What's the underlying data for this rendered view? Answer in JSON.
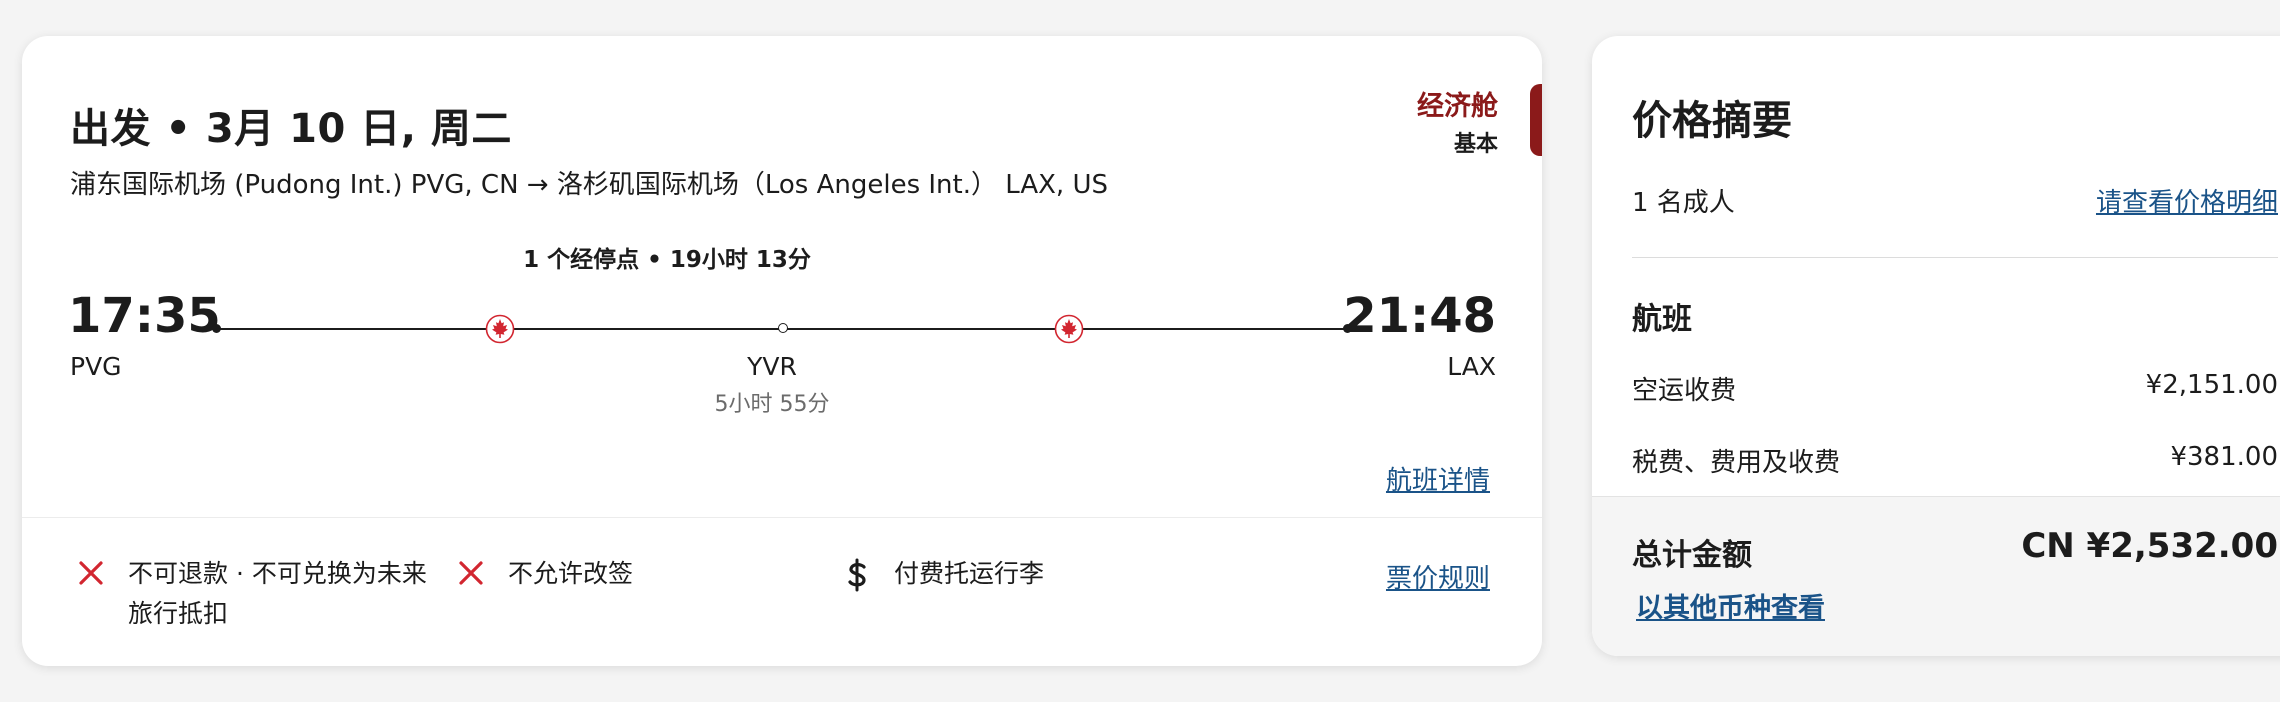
{
  "flight": {
    "departure_title": "出发 • 3月 10 日, 周二",
    "route": "浦东国际机场 (Pudong Int.) PVG, CN → 洛杉矶国际机场（Los Angeles Int.） LAX, US",
    "cabin": {
      "name": "经济舱",
      "fare_type": "基本"
    },
    "stops_info": "1 个经停点  •  19小时 13分",
    "depart_time": "17:35",
    "depart_code": "PVG",
    "arrive_time": "21:48",
    "arrive_code": "LAX",
    "stop_code": "YVR",
    "layover": "5小时 55分",
    "details_link": "航班详情",
    "features": [
      {
        "icon": "x-icon",
        "text": "不可退款 · 不可兑换为未来旅行抵扣"
      },
      {
        "icon": "x-icon",
        "text": "不允许改签"
      },
      {
        "icon": "dollar-icon",
        "text": "付费托运行李"
      }
    ],
    "fare_rules_link": "票价规则"
  },
  "summary": {
    "title": "价格摘要",
    "passengers": "1 名成人",
    "breakdown_link": "请查看价格明细",
    "section_title": "航班",
    "rows": [
      {
        "label": "空运收费",
        "value": "¥2,151.00"
      },
      {
        "label": "税费、费用及收费",
        "value": "¥381.00"
      }
    ],
    "total_label": "总计金额",
    "total_value": "CN ¥2,532.00",
    "currency_link": "以其他币种查看"
  },
  "colors": {
    "brand_red": "#d22630",
    "cabin_red": "#8b1a1a",
    "link_blue": "#1a5388"
  }
}
